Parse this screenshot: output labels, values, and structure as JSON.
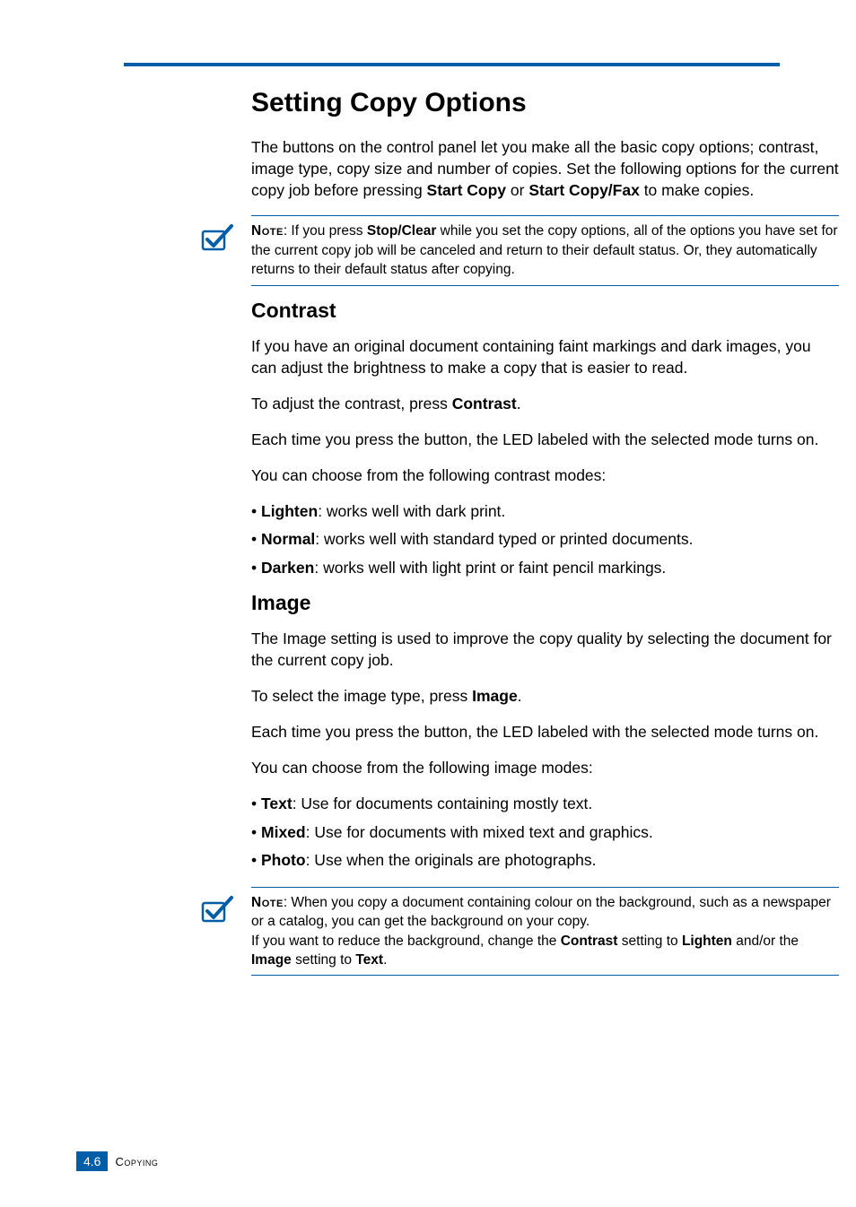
{
  "h1": "Setting Copy Options",
  "intro": "The buttons on the control panel let you make all the basic copy options; contrast, image type, copy size and number of copies. Set the following options for the current copy job before pressing ",
  "intro_b1": "Start Copy",
  "intro_mid": " or ",
  "intro_b2": "Start Copy/Fax",
  "intro_end": " to make copies.",
  "note1_label": "Note",
  "note1_a": ": If you press ",
  "note1_b": "Stop/Clear",
  "note1_c": " while you set the copy options, all of the options you have set for the current copy job will be canceled and return to their default status. Or, they automatically returns to their default status after copying.",
  "contrast": {
    "title": "Contrast",
    "p1": "If you have an original document containing faint markings and dark images, you can adjust the brightness to make a copy that is easier to read.",
    "p2a": "To adjust the contrast, press ",
    "p2b": "Contrast",
    "p2c": ".",
    "p3": "Each time you press the button, the LED labeled with the selected mode turns on.",
    "p4": "You can choose from the following contrast modes:",
    "bullets": [
      {
        "b": "Lighten",
        "t": ": works well with dark print."
      },
      {
        "b": "Normal",
        "t": ": works well with standard typed or printed documents."
      },
      {
        "b": "Darken",
        "t": ": works well with light print or faint pencil markings."
      }
    ]
  },
  "image": {
    "title": "Image",
    "p1": "The Image setting is used to improve the copy quality by selecting the document for the current copy job.",
    "p2a": "To select the image type, press ",
    "p2b": "Image",
    "p2c": ".",
    "p3": "Each time you press the button, the LED labeled with the selected mode turns on.",
    "p4": "You can choose from the following image modes:",
    "bullets": [
      {
        "b": "Text",
        "t": ": Use for documents containing mostly text."
      },
      {
        "b": "Mixed",
        "t": ": Use for documents with mixed text and graphics."
      },
      {
        "b": "Photo",
        "t": ": Use when the originals are photographs."
      }
    ]
  },
  "note2_label": "Note",
  "note2_a": ": When you copy a document containing colour on the background, such as a newspaper or a catalog, you can get the background on your copy.",
  "note2_b1": "If you want to reduce the background, change the ",
  "note2_b2": "Contrast",
  "note2_b3": " setting to ",
  "note2_b4": "Lighten",
  "note2_b5": " and/or the ",
  "note2_b6": "Image",
  "note2_b7": " setting to ",
  "note2_b8": "Text",
  "note2_b9": ".",
  "footer": {
    "page": "4.6",
    "label": "Copying"
  }
}
